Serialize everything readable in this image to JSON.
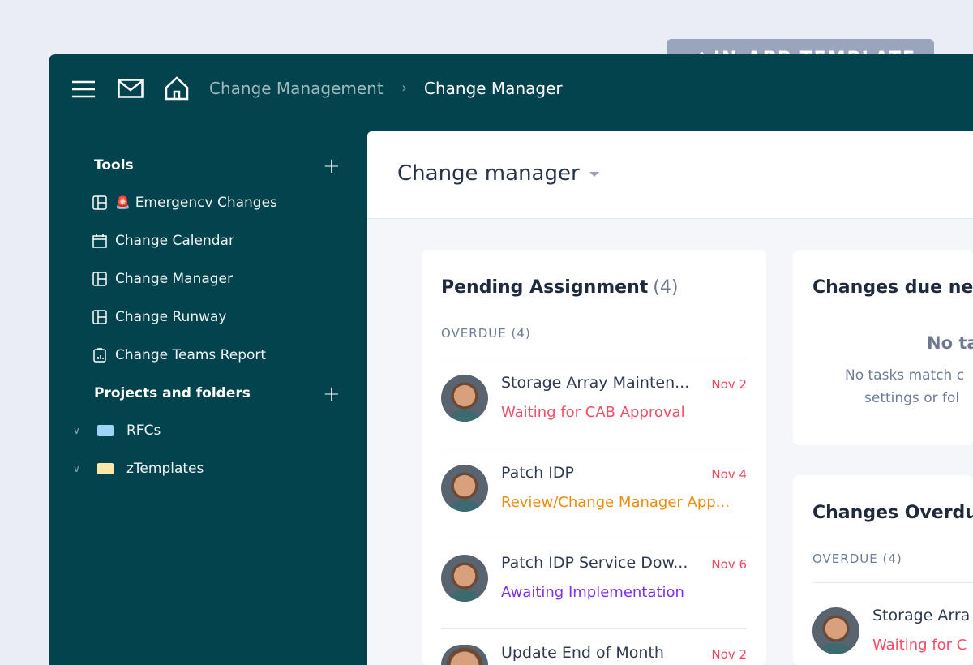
{
  "badge": {
    "label": "IN-APP TEMPLATE",
    "icon": "check-icon"
  },
  "topbar": {
    "breadcrumb": [
      "Change Management",
      "Change Manager"
    ]
  },
  "sidebar": {
    "tools_label": "Tools",
    "tools": [
      {
        "label": "Emergencv Changes",
        "icon": "dashboard-icon",
        "emoji": "🚨"
      },
      {
        "label": "Change Calendar",
        "icon": "calendar-icon"
      },
      {
        "label": "Change Manager",
        "icon": "dashboard-icon"
      },
      {
        "label": "Change Runway",
        "icon": "dashboard-icon"
      },
      {
        "label": "Change Teams Report",
        "icon": "report-icon"
      }
    ],
    "projects_label": "Projects and folders",
    "folders": [
      {
        "label": "RFCs",
        "color": "#9fd3f7"
      },
      {
        "label": "zTemplates",
        "color": "#fbe7a8"
      }
    ]
  },
  "main": {
    "title": "Change manager",
    "pending": {
      "title": "Pending Assignment",
      "count": "(4)",
      "section": "OVERDUE (4)",
      "items": [
        {
          "title": "Storage Array Mainten...",
          "date": "Nov 2",
          "status": "Waiting for CAB Approval",
          "status_color": "#f54d64"
        },
        {
          "title": "Patch IDP",
          "date": "Nov 4",
          "status": "Review/Change Manager App...",
          "status_color": "#f08a0c"
        },
        {
          "title": "Patch IDP Service Dow...",
          "date": "Nov 6",
          "status": "Awaiting Implementation",
          "status_color": "#7b2ff0"
        },
        {
          "title": "Update End of Month",
          "date": "Nov 2",
          "status": "",
          "status_color": "#f54d64"
        }
      ]
    },
    "due_next": {
      "title": "Changes due nex",
      "empty_title": "No ta",
      "empty_line1": "No tasks match c",
      "empty_line2": "settings or fol"
    },
    "overdue": {
      "title": "Changes Overdue",
      "section": "OVERDUE (4)",
      "item": {
        "title": "Storage Arra",
        "status": "Waiting for C"
      }
    }
  }
}
